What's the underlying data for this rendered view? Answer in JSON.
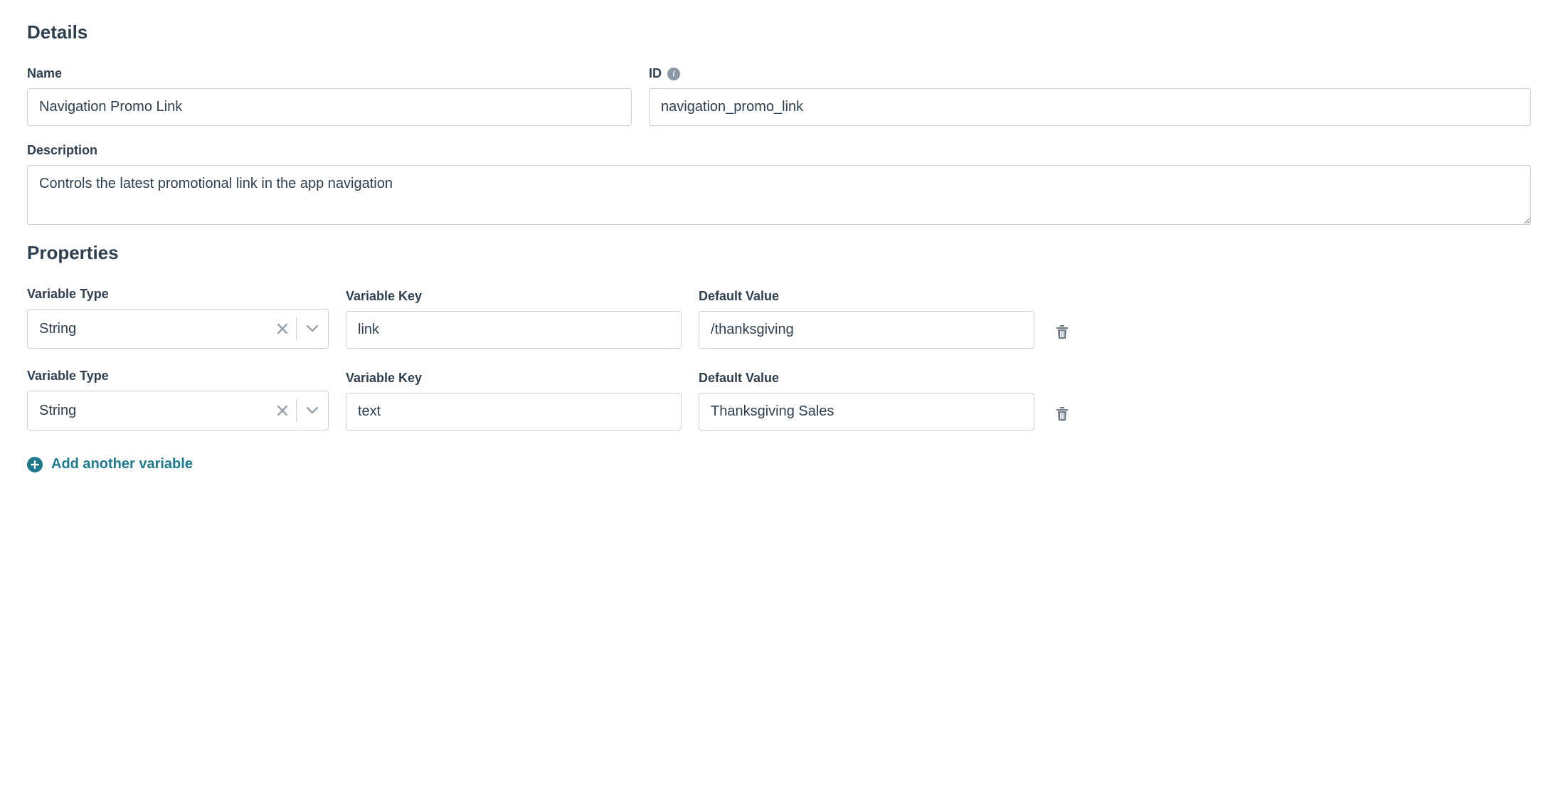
{
  "details": {
    "heading": "Details",
    "name_label": "Name",
    "name_value": "Navigation Promo Link",
    "id_label": "ID",
    "id_value": "navigation_promo_link",
    "description_label": "Description",
    "description_value": "Controls the latest promotional link in the app navigation"
  },
  "properties": {
    "heading": "Properties",
    "type_label": "Variable Type",
    "key_label": "Variable Key",
    "value_label": "Default Value",
    "rows": [
      {
        "type": "String",
        "key": "link",
        "value": "/thanksgiving"
      },
      {
        "type": "String",
        "key": "text",
        "value": "Thanksgiving Sales"
      }
    ],
    "add_label": "Add another variable"
  }
}
